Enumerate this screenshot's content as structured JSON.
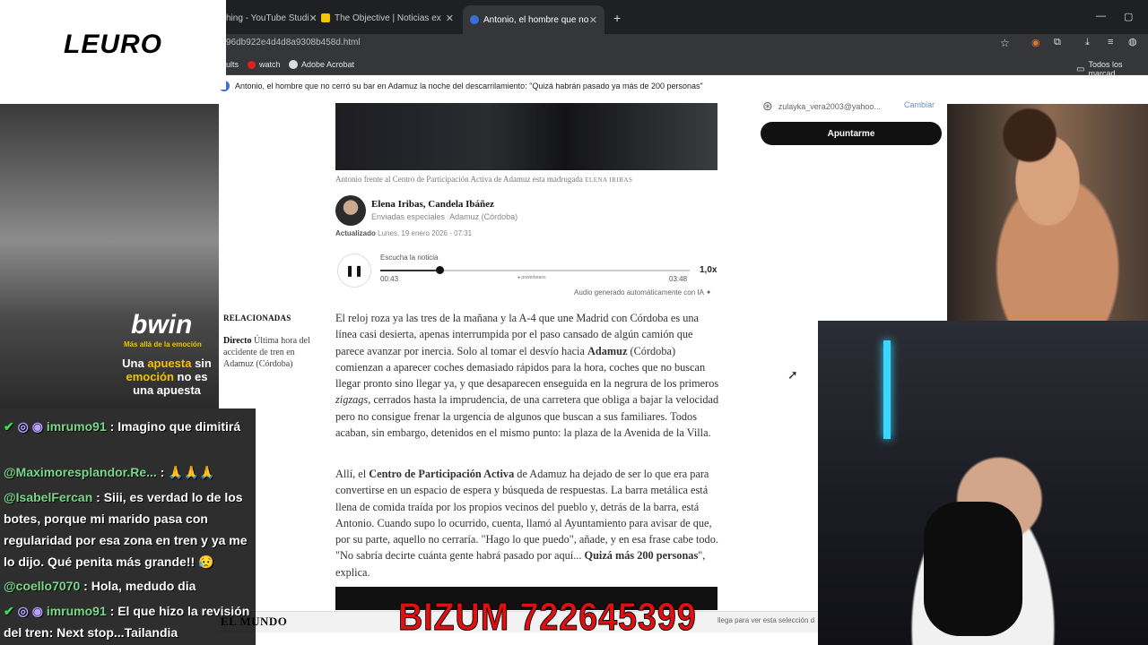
{
  "browser": {
    "tabs": [
      {
        "label": "hing - YouTube Studi"
      },
      {
        "label": "The Objective | Noticias ex"
      },
      {
        "label": "Antonio, el hombre que no"
      }
    ],
    "url": "96db922e4d4d8a9308b458d.html",
    "bookmarks": [
      {
        "label": "ults"
      },
      {
        "label": "watch"
      },
      {
        "label": "Adobe Acrobat"
      },
      {
        "label": "Todos los marcad"
      }
    ]
  },
  "article": {
    "headline": "Antonio, el hombre que no cerró su bar en Adamuz la noche del descarrilamiento: \"Quizá habrán pasado ya más de 200 personas\"",
    "caption": "Antonio frente al Centro de Participación Activa de Adamuz esta madrugada",
    "caption_credit": "ELENA IRIBAS",
    "authors": "Elena Iribas, Candela Ibáñez",
    "role": "Enviadas especiales",
    "location": "Adamuz (Córdoba)",
    "updated_label": "Actualizado",
    "updated": "Lunes, 19 enero 2026 - 07:31",
    "player": {
      "listen_label": "Escucha la noticia",
      "elapsed": "00:43",
      "total": "03:48",
      "progress": 0.19,
      "speed": "1,0x",
      "brand": "powerbeans",
      "ai_note": "Audio generado automáticamente con IA"
    },
    "related_heading": "RELACIONADAS",
    "related_direct": "Directo",
    "related_text": "Última hora del accidente de tren en Adamuz (Córdoba)",
    "p1_a": "El reloj roza ya las tres de la mañana y la A-4 que une Madrid con Córdoba es una línea casi desierta, apenas interrumpida por el paso cansado de algún camión que parece avanzar por inercia. Solo al tomar el desvío hacia ",
    "p1_b": "Adamuz",
    "p1_c": " (Córdoba) comienzan a aparecer coches demasiado rápidos para la hora, coches que no buscan llegar pronto sino llegar ya, y que desaparecen enseguida en la negrura de los primeros ",
    "p1_d": "zigzags",
    "p1_e": ", cerrados hasta la imprudencia, de una carretera que obliga a bajar la velocidad pero no consigue frenar la urgencia de algunos que buscan a sus familiares. Todos acaban, sin embargo, detenidos en el mismo punto: la plaza de la Avenida de la Villa.",
    "p2_a": "Allí, el ",
    "p2_b": "Centro de Participación Activa",
    "p2_c": " de Adamuz ha dejado de ser lo que era para convertirse en un espacio de espera y búsqueda de respuestas. La barra metálica está llena de comida traída por los propios vecinos del pueblo y, detrás de la barra, está Antonio. Cuando supo lo ocurrido, cuenta, llamó al Ayuntamiento para avisar de que, por su parte, aquello no cerraría. \"Hago lo que puedo\", añade, y en esa frase cabe todo. \"No sabría decirte cuánta gente habrá pasado por aquí... ",
    "p2_d": "Quizá más 200 personas",
    "p2_e": "\", explica.",
    "footer_logo": "EL MUNDO",
    "cookie_note": "llega para ver esta selección d"
  },
  "sidebar": {
    "email": "zulayka_vera2003@yahoo...",
    "change": "Cambiar",
    "subscribe": "Apuntarme"
  },
  "overlay": {
    "logo": "LEURO",
    "bwin": "bwin",
    "bwin_sub": "Más allá de la emoción",
    "ad_1": "Una ",
    "ad_2": "apuesta",
    "ad_3": " sin ",
    "ad_4": "emoción",
    "ad_5": " no es una apuesta",
    "bizum": "BIZUM 722645399"
  },
  "chat": [
    {
      "user": "imrumo91",
      "sep": " : ",
      "text": "Imagino que dimitirá"
    },
    {
      "user": "@Maximoresplandor.Re...",
      "sep": " : ",
      "text": "🙏🙏🙏"
    },
    {
      "user": "@IsabelFercan",
      "sep": " : ",
      "text": "Siii, es verdad lo de los botes, porque mi marido pasa con regularidad por esa zona en tren y ya me lo dijo. Qué penita más grande!! 😥"
    },
    {
      "user": "@coello7070",
      "sep": " : ",
      "text": "Hola, medudo dia"
    },
    {
      "user": "imrumo91",
      "sep": " : ",
      "text": "El que hizo la revisión del tren: Next stop...Tailandia"
    }
  ]
}
